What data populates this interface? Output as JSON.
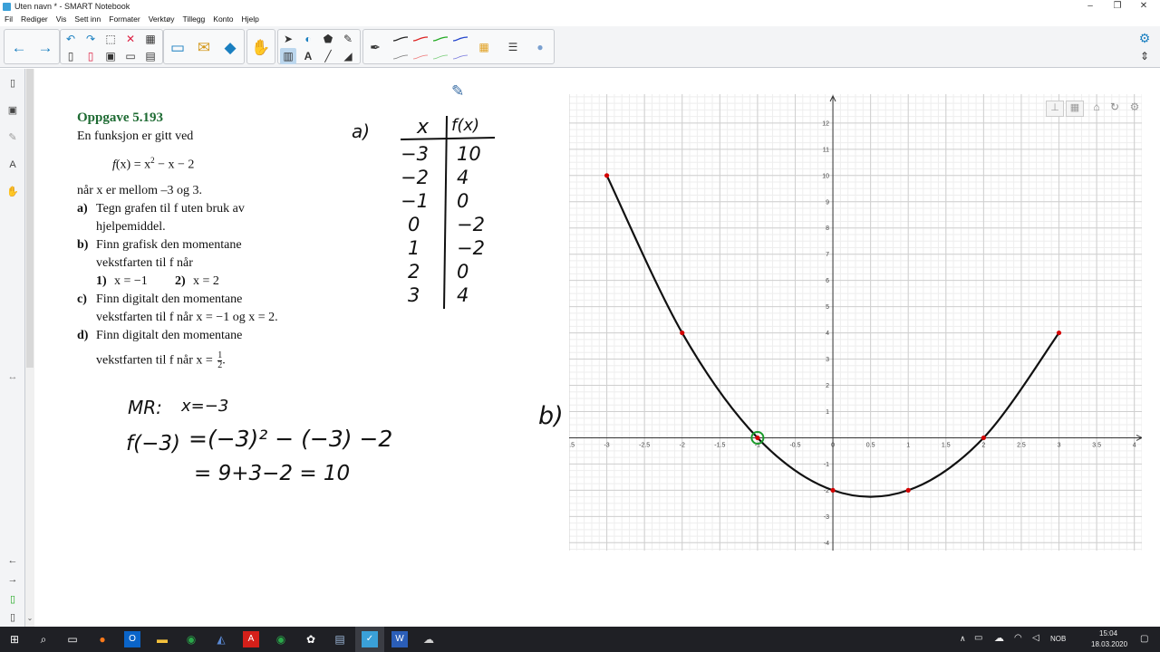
{
  "window": {
    "title": "Uten navn * - SMART Notebook"
  },
  "menu": [
    "Fil",
    "Rediger",
    "Vis",
    "Sett inn",
    "Formater",
    "Verktøy",
    "Tillegg",
    "Konto",
    "Hjelp"
  ],
  "colors": {
    "accent": "#1a7fc0",
    "heading_green": "#1e6b33",
    "plot_point": "#d40000",
    "marker_green": "#1a9a2a",
    "taskbar": "#1f2025"
  },
  "book": {
    "heading": "Oppgave 5.193",
    "intro": "En funksjon er gitt ved",
    "formula_lhs": "f",
    "formula_mid": "(x) = x",
    "formula_exp": "2",
    "formula_rhs": " − x − 2",
    "range_text": "når x er mellom –3 og 3.",
    "a_label": "a)",
    "a_text1": "Tegn grafen til f uten bruk av",
    "a_text2": "hjelpemiddel.",
    "b_label": "b)",
    "b_text1": "Finn grafisk den momentane",
    "b_text2": "vekstfarten til f når",
    "b_sub1_label": "1)",
    "b_sub1": "x = −1",
    "b_sub2_label": "2)",
    "b_sub2": "x = 2",
    "c_label": "c)",
    "c_text1": "Finn digitalt den momentane",
    "c_text2": "vekstfarten til f når x = −1 og x = 2.",
    "d_label": "d)",
    "d_text1": "Finn digitalt den momentane",
    "d_text2a": "vekstfarten til f når x =",
    "d_frac_num": "1",
    "d_frac_den": "2",
    "d_text2b": "."
  },
  "handwriting": {
    "part_a": "a)",
    "table_header_x": "x",
    "table_header_f": "f(x)",
    "x_values": [
      "−3",
      "−2",
      "−1",
      "0",
      "1",
      "2",
      "3"
    ],
    "f_values": [
      "10",
      "4",
      "0",
      "−2",
      "−2",
      "0",
      "4"
    ],
    "mr_label": "MR:",
    "mr_value": "x=−3",
    "calc_line1_lhs": "f(−3)",
    "calc_line1_rhs": "=(−3)² − (−3) −2",
    "calc_line2": "= 9+3−2 = 10",
    "part_b": "b)"
  },
  "chart_data": {
    "type": "line",
    "x_ticks": [
      "-3.5",
      "-3",
      "-2.5",
      "-2",
      "-1.5",
      "-1",
      "-0.5",
      "0",
      "0.5",
      "1",
      "1.5",
      "2",
      "2.5",
      "3",
      "3.5",
      "4"
    ],
    "y_ticks": [
      "12",
      "11",
      "10",
      "9",
      "8",
      "7",
      "6",
      "5",
      "4",
      "3",
      "2",
      "1",
      "-1",
      "-2",
      "-3",
      "-4"
    ],
    "xlim": [
      -3.5,
      4.1
    ],
    "ylim": [
      -4.3,
      13.1
    ],
    "grid": true,
    "points": [
      {
        "x": -3,
        "y": 10
      },
      {
        "x": -2,
        "y": 4
      },
      {
        "x": -1,
        "y": 0
      },
      {
        "x": 0,
        "y": -2
      },
      {
        "x": 1,
        "y": -2
      },
      {
        "x": 2,
        "y": 0
      },
      {
        "x": 3,
        "y": 4
      }
    ],
    "marked_point": {
      "x": -1,
      "y": 0
    },
    "graph_toolbar": [
      "graph-view-icon",
      "grid-icon",
      "home-icon",
      "undo-icon",
      "settings-icon"
    ]
  },
  "taskbar": {
    "apps": [
      "start-icon",
      "search-icon",
      "task-view-icon",
      "firefox-icon",
      "outlook-icon",
      "file-explorer-icon",
      "geogebra-icon",
      "mathcad-icon",
      "acrobat-icon",
      "geogebra-classic-icon",
      "settings-app-icon",
      "files-icon",
      "smart-notebook-icon",
      "word-icon",
      "remote-icon"
    ],
    "language": "NOB",
    "time": "15:04",
    "date": "18.03.2020"
  }
}
